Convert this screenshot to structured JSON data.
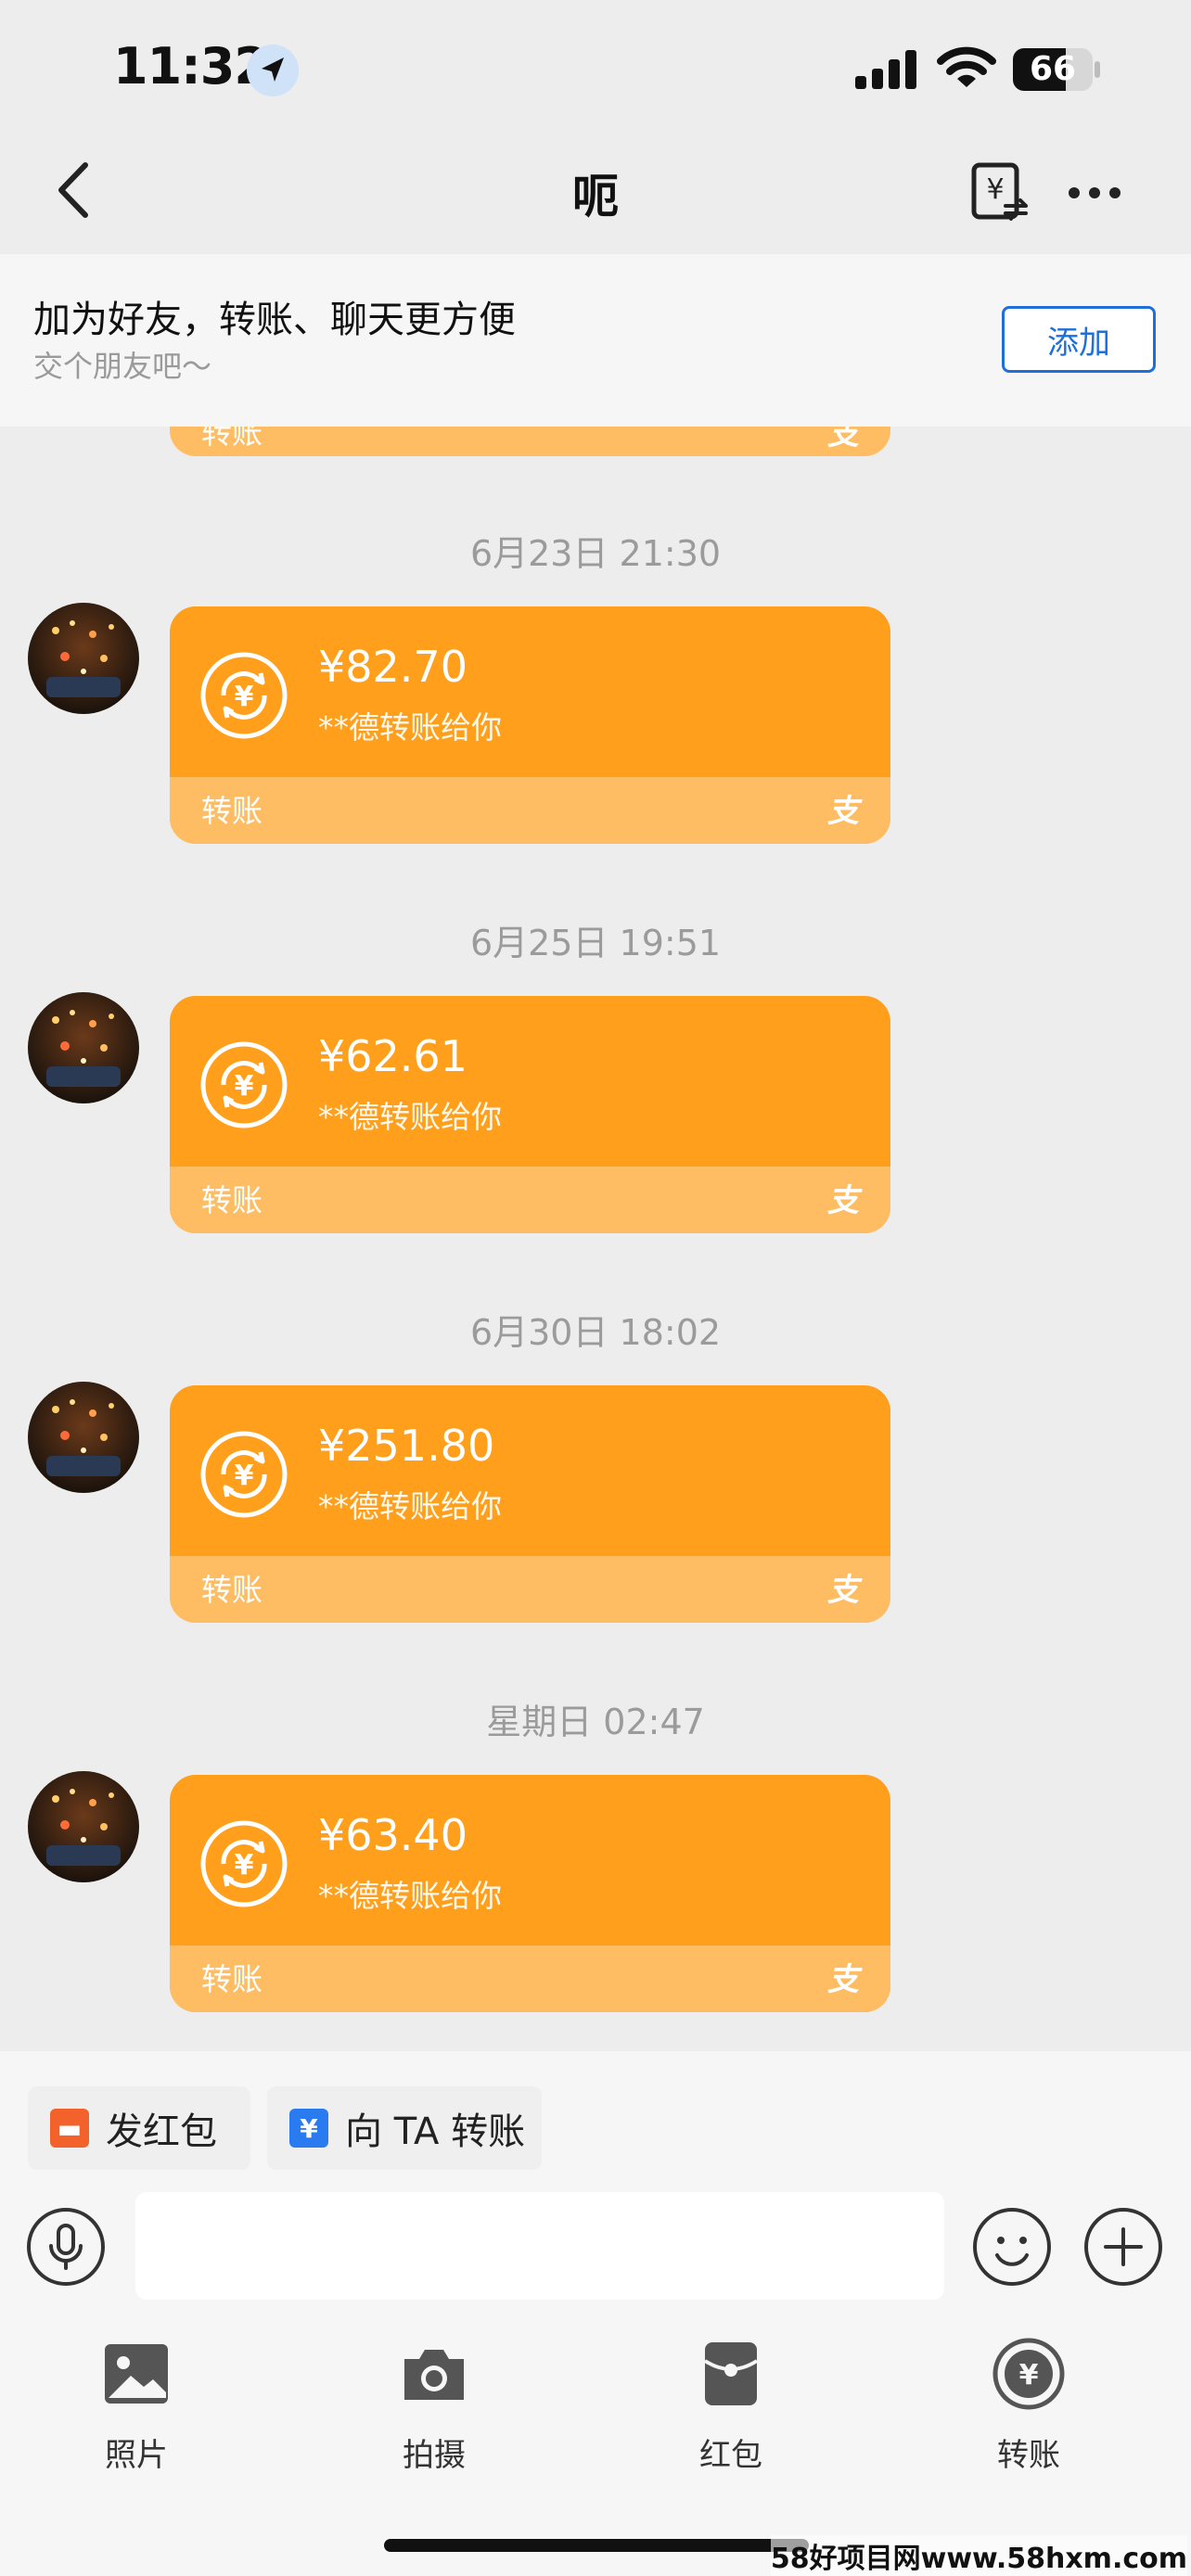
{
  "status_bar": {
    "time": "11:32",
    "battery": "66",
    "battery_level": 0.66
  },
  "nav": {
    "title": "呃"
  },
  "banner": {
    "title": "加为好友，转账、聊天更方便",
    "subtitle": "交个朋友吧～",
    "add_label": "添加"
  },
  "partial_card": {
    "label": "转账",
    "alipay": "支"
  },
  "messages": [
    {
      "timestamp": "6月23日 21:30",
      "amount": "¥82.70",
      "desc": "**德转账给你",
      "label": "转账",
      "alipay": "支"
    },
    {
      "timestamp": "6月25日 19:51",
      "amount": "¥62.61",
      "desc": "**德转账给你",
      "label": "转账",
      "alipay": "支"
    },
    {
      "timestamp": "6月30日 18:02",
      "amount": "¥251.80",
      "desc": "**德转账给你",
      "label": "转账",
      "alipay": "支"
    },
    {
      "timestamp": "星期日 02:47",
      "amount": "¥63.40",
      "desc": "**德转账给你",
      "label": "转账",
      "alipay": "支"
    }
  ],
  "quick_actions": {
    "red_packet": "发红包",
    "transfer": "向 TA 转账"
  },
  "tools": [
    {
      "label": "照片",
      "icon": "photo-icon"
    },
    {
      "label": "拍摄",
      "icon": "camera-icon"
    },
    {
      "label": "红包",
      "icon": "red-packet-icon"
    },
    {
      "label": "转账",
      "icon": "transfer-icon"
    }
  ],
  "watermark": "58好项目网www.58hxm.com",
  "colors": {
    "card": "#ff9f1c",
    "card_bottom": "#ffbd63",
    "accent_blue": "#1e6fd9"
  }
}
